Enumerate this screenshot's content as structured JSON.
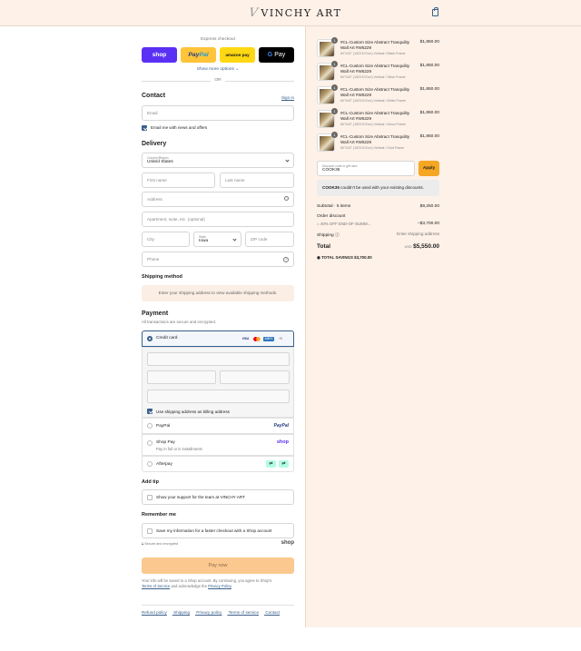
{
  "header": {
    "brand": "VINCHY ART"
  },
  "express": {
    "label": "Express checkout",
    "shop_label": "shop",
    "paypal_label_a": "Pay",
    "paypal_label_b": "Pal",
    "amazon_label": "amazon pay",
    "gpay_g": "G",
    "gpay_label": "Pay",
    "more_label": "Show more options",
    "or_label": "OR"
  },
  "contact": {
    "title": "Contact",
    "signin": "Sign in",
    "email_placeholder": "Email",
    "news_label": "Email me with news and offers"
  },
  "delivery": {
    "title": "Delivery",
    "country_label": "Country/Region",
    "country_value": "United States",
    "first_name": "First name",
    "last_name": "Last name",
    "address": "Address",
    "apartment": "Apartment, suite, etc. (optional)",
    "city": "City",
    "state_label": "State",
    "state_value": "Iowa",
    "zip": "ZIP code",
    "phone": "Phone"
  },
  "shipping": {
    "title": "Shipping method",
    "notice": "Enter your shipping address to view available shipping methods."
  },
  "payment": {
    "title": "Payment",
    "subtitle": "All transactions are secure and encrypted.",
    "credit_card": "Credit card",
    "card_visa": "VISA",
    "card_amex": "AMEX",
    "card_more": "+5",
    "billing_same": "Use shipping address as billing address",
    "paypal": "PayPal",
    "paypal_logo": "PayPal",
    "shop_pay": "Shop Pay",
    "shop_pay_sub": "Pay in full or in installments",
    "shop_pay_logo": "shop",
    "afterpay": "Afterpay"
  },
  "tip": {
    "title": "Add tip",
    "label": "Show your support for the team at VINCHY ART"
  },
  "remember": {
    "title": "Remember me",
    "label": "Save my information for a faster checkout with a Shop account",
    "secure": "Secure and encrypted",
    "shop_logo": "shop"
  },
  "paynow": {
    "label": "Pay now",
    "legal_1": "Your info will be saved to a Shop account. By continuing, you agree to Shop's",
    "legal_tos": "Terms of Service",
    "legal_2": " and acknowledge the ",
    "legal_privacy": "Privacy Policy",
    "legal_3": "."
  },
  "footer": {
    "links": [
      "Refund policy",
      "Shipping",
      "Privacy policy",
      "Terms of service",
      "Contact"
    ]
  },
  "cart": {
    "items": [
      {
        "qty": "1",
        "title": "#CL-Custom Size Abstract Tranquility Wall Art #W5229",
        "variant": "60\"X42\" (152X107cm) Vertical / Black Frame",
        "price": "$1,850.00"
      },
      {
        "qty": "1",
        "title": "#CL-Custom Size Abstract Tranquility Wall Art #W5229",
        "variant": "60\"X42\" (152X107cm) Vertical / Silver Frame",
        "price": "$1,850.00"
      },
      {
        "qty": "1",
        "title": "#CL-Custom Size Abstract Tranquility Wall Art #W5229",
        "variant": "60\"X42\" (152X107cm) Vertical / White Frame",
        "price": "$1,850.00"
      },
      {
        "qty": "1",
        "title": "#CL-Custom Size Abstract Tranquility Wall Art #W5229",
        "variant": "60\"X42\" (152X107cm) Vertical / Wood Frame",
        "price": "$1,850.00"
      },
      {
        "qty": "1",
        "title": "#CL-Custom Size Abstract Tranquility Wall Art #W5229",
        "variant": "60\"X42\" (152X107cm) Vertical / Gold Frame",
        "price": "$1,850.00"
      }
    ],
    "discount_label": "Discount code or gift card",
    "discount_value": "COOK35",
    "apply": "Apply",
    "error_code": "COOK35",
    "error_msg": " couldn't be used with your existing discounts.",
    "subtotal_label": "Subtotal · 5 items",
    "subtotal_value": "$9,250.00",
    "order_discount_label": "Order discount",
    "discount_name": "40% OFF END-OF-SUMM...",
    "discount_value_amt": "−$3,700.00",
    "shipping_label": "Shipping",
    "shipping_value": "Enter shipping address",
    "total_label": "Total",
    "currency": "USD",
    "total_value": "$5,550.00",
    "savings_label": "TOTAL SAVINGS",
    "savings_value": "$3,700.00"
  },
  "colors": {
    "accent": "#3a5f8a",
    "paynow": "#fbc88f",
    "page_bg": "#fdf1e8"
  }
}
